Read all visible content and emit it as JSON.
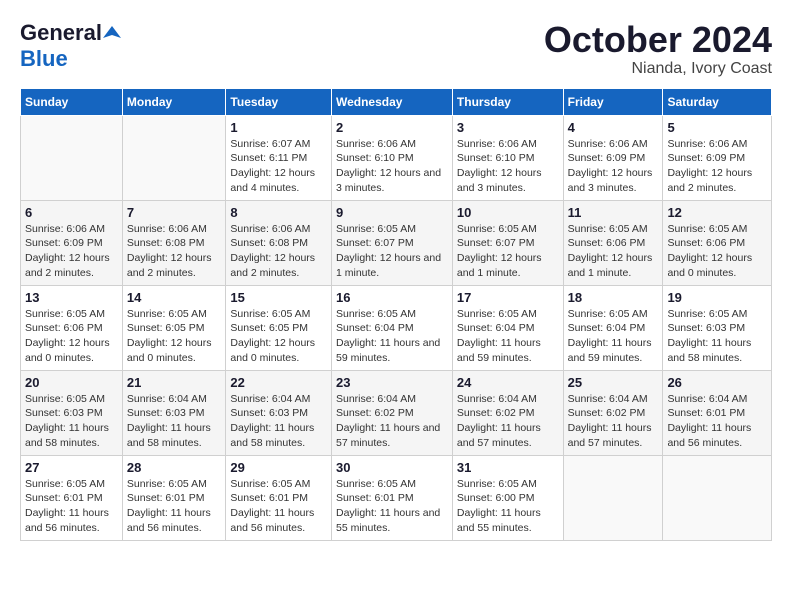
{
  "logo": {
    "line1": "General",
    "line2": "Blue"
  },
  "title": "October 2024",
  "subtitle": "Nianda, Ivory Coast",
  "days_of_week": [
    "Sunday",
    "Monday",
    "Tuesday",
    "Wednesday",
    "Thursday",
    "Friday",
    "Saturday"
  ],
  "weeks": [
    [
      {
        "num": "",
        "info": ""
      },
      {
        "num": "",
        "info": ""
      },
      {
        "num": "1",
        "info": "Sunrise: 6:07 AM\nSunset: 6:11 PM\nDaylight: 12 hours and 4 minutes."
      },
      {
        "num": "2",
        "info": "Sunrise: 6:06 AM\nSunset: 6:10 PM\nDaylight: 12 hours and 3 minutes."
      },
      {
        "num": "3",
        "info": "Sunrise: 6:06 AM\nSunset: 6:10 PM\nDaylight: 12 hours and 3 minutes."
      },
      {
        "num": "4",
        "info": "Sunrise: 6:06 AM\nSunset: 6:09 PM\nDaylight: 12 hours and 3 minutes."
      },
      {
        "num": "5",
        "info": "Sunrise: 6:06 AM\nSunset: 6:09 PM\nDaylight: 12 hours and 2 minutes."
      }
    ],
    [
      {
        "num": "6",
        "info": "Sunrise: 6:06 AM\nSunset: 6:09 PM\nDaylight: 12 hours and 2 minutes."
      },
      {
        "num": "7",
        "info": "Sunrise: 6:06 AM\nSunset: 6:08 PM\nDaylight: 12 hours and 2 minutes."
      },
      {
        "num": "8",
        "info": "Sunrise: 6:06 AM\nSunset: 6:08 PM\nDaylight: 12 hours and 2 minutes."
      },
      {
        "num": "9",
        "info": "Sunrise: 6:05 AM\nSunset: 6:07 PM\nDaylight: 12 hours and 1 minute."
      },
      {
        "num": "10",
        "info": "Sunrise: 6:05 AM\nSunset: 6:07 PM\nDaylight: 12 hours and 1 minute."
      },
      {
        "num": "11",
        "info": "Sunrise: 6:05 AM\nSunset: 6:06 PM\nDaylight: 12 hours and 1 minute."
      },
      {
        "num": "12",
        "info": "Sunrise: 6:05 AM\nSunset: 6:06 PM\nDaylight: 12 hours and 0 minutes."
      }
    ],
    [
      {
        "num": "13",
        "info": "Sunrise: 6:05 AM\nSunset: 6:06 PM\nDaylight: 12 hours and 0 minutes."
      },
      {
        "num": "14",
        "info": "Sunrise: 6:05 AM\nSunset: 6:05 PM\nDaylight: 12 hours and 0 minutes."
      },
      {
        "num": "15",
        "info": "Sunrise: 6:05 AM\nSunset: 6:05 PM\nDaylight: 12 hours and 0 minutes."
      },
      {
        "num": "16",
        "info": "Sunrise: 6:05 AM\nSunset: 6:04 PM\nDaylight: 11 hours and 59 minutes."
      },
      {
        "num": "17",
        "info": "Sunrise: 6:05 AM\nSunset: 6:04 PM\nDaylight: 11 hours and 59 minutes."
      },
      {
        "num": "18",
        "info": "Sunrise: 6:05 AM\nSunset: 6:04 PM\nDaylight: 11 hours and 59 minutes."
      },
      {
        "num": "19",
        "info": "Sunrise: 6:05 AM\nSunset: 6:03 PM\nDaylight: 11 hours and 58 minutes."
      }
    ],
    [
      {
        "num": "20",
        "info": "Sunrise: 6:05 AM\nSunset: 6:03 PM\nDaylight: 11 hours and 58 minutes."
      },
      {
        "num": "21",
        "info": "Sunrise: 6:04 AM\nSunset: 6:03 PM\nDaylight: 11 hours and 58 minutes."
      },
      {
        "num": "22",
        "info": "Sunrise: 6:04 AM\nSunset: 6:03 PM\nDaylight: 11 hours and 58 minutes."
      },
      {
        "num": "23",
        "info": "Sunrise: 6:04 AM\nSunset: 6:02 PM\nDaylight: 11 hours and 57 minutes."
      },
      {
        "num": "24",
        "info": "Sunrise: 6:04 AM\nSunset: 6:02 PM\nDaylight: 11 hours and 57 minutes."
      },
      {
        "num": "25",
        "info": "Sunrise: 6:04 AM\nSunset: 6:02 PM\nDaylight: 11 hours and 57 minutes."
      },
      {
        "num": "26",
        "info": "Sunrise: 6:04 AM\nSunset: 6:01 PM\nDaylight: 11 hours and 56 minutes."
      }
    ],
    [
      {
        "num": "27",
        "info": "Sunrise: 6:05 AM\nSunset: 6:01 PM\nDaylight: 11 hours and 56 minutes."
      },
      {
        "num": "28",
        "info": "Sunrise: 6:05 AM\nSunset: 6:01 PM\nDaylight: 11 hours and 56 minutes."
      },
      {
        "num": "29",
        "info": "Sunrise: 6:05 AM\nSunset: 6:01 PM\nDaylight: 11 hours and 56 minutes."
      },
      {
        "num": "30",
        "info": "Sunrise: 6:05 AM\nSunset: 6:01 PM\nDaylight: 11 hours and 55 minutes."
      },
      {
        "num": "31",
        "info": "Sunrise: 6:05 AM\nSunset: 6:00 PM\nDaylight: 11 hours and 55 minutes."
      },
      {
        "num": "",
        "info": ""
      },
      {
        "num": "",
        "info": ""
      }
    ]
  ]
}
